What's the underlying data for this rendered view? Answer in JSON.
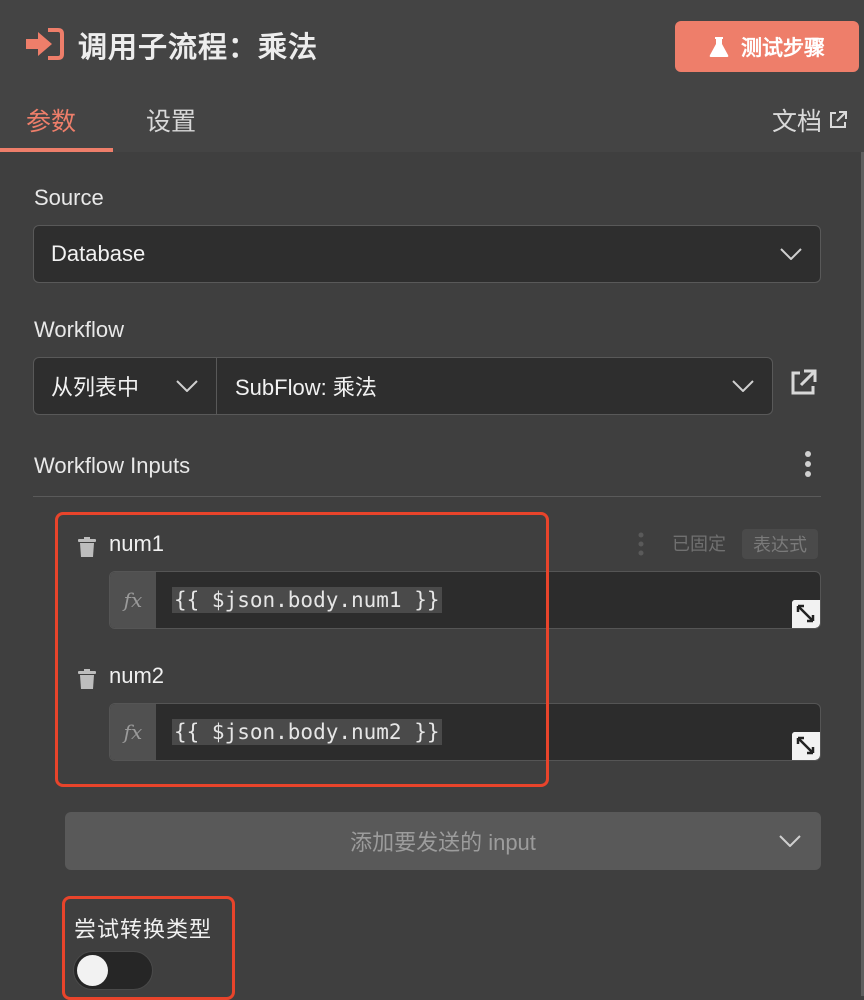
{
  "header": {
    "title": "调用子流程：乘法",
    "icon": "sign-in-icon",
    "test_button": "测试步骤",
    "test_icon": "flask-icon",
    "accent_color": "#ee7e6a"
  },
  "tabs": [
    {
      "label": "参数",
      "active": true
    },
    {
      "label": "设置",
      "active": false
    }
  ],
  "docs_link": "文档",
  "source": {
    "label": "Source",
    "value": "Database"
  },
  "workflow": {
    "label": "Workflow",
    "mode": "从列表中",
    "value": "SubFlow: 乘法"
  },
  "workflow_inputs": {
    "label": "Workflow Inputs",
    "items": [
      {
        "name": "num1",
        "expression": "{{ $json.body.num1 }}"
      },
      {
        "name": "num2",
        "expression": "{{ $json.body.num2 }}"
      }
    ],
    "fx": "fx",
    "hover_actions": {
      "pinned": "已固定",
      "expression": "表达式"
    },
    "add_input_placeholder": "添加要发送的 input"
  },
  "convert_types": {
    "label": "尝试转换类型",
    "enabled": false
  },
  "highlight_color": "#e8442b"
}
